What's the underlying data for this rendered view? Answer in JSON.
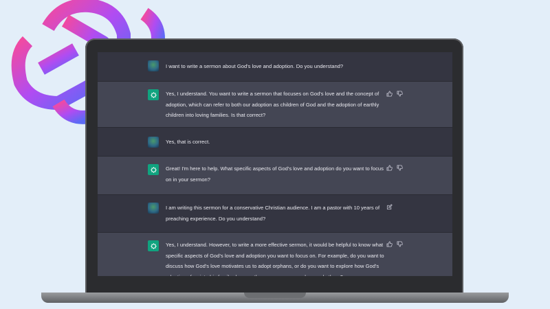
{
  "colors": {
    "page_bg": "#e3eef9",
    "chat_user_bg": "#343541",
    "chat_bot_bg": "#444654",
    "bot_avatar": "#10a37f",
    "logo_gradient": [
      "#f24aa0",
      "#b04cf2",
      "#5b6af5"
    ]
  },
  "icons": {
    "background_logo": "openai-logo-icon",
    "bot_avatar": "chatgpt-logo-icon",
    "user_avatar": "user-avatar-icon",
    "thumbs_up": "thumbs-up-icon",
    "thumbs_down": "thumbs-down-icon",
    "edit": "edit-icon"
  },
  "messages": [
    {
      "role": "user",
      "text": "I want to write a sermon about God's love and adoption. Do you understand?"
    },
    {
      "role": "assistant",
      "text": "Yes, I understand. You want to write a sermon that focuses on God's love and the concept of adoption, which can refer to both our adoption as children of God and the adoption of earthly children into loving families. Is that correct?"
    },
    {
      "role": "user",
      "text": "Yes, that is correct."
    },
    {
      "role": "assistant",
      "text": "Great! I'm here to help. What specific aspects of God's love and adoption do you want to focus on in your sermon?"
    },
    {
      "role": "user",
      "text": "I am writing this sermon for a conservative Christian audience. I am a pastor with 10 years of preaching experience. Do you understand?"
    },
    {
      "role": "assistant",
      "text": "Yes, I understand. However, to write a more effective sermon, it would be helpful to know what specific aspects of God's love and adoption you want to focus on. For example, do you want to discuss how God's love motivates us to adopt orphans, or do you want to explore how God's adoption of us into his family changes the way we see ourselves and others?"
    }
  ]
}
